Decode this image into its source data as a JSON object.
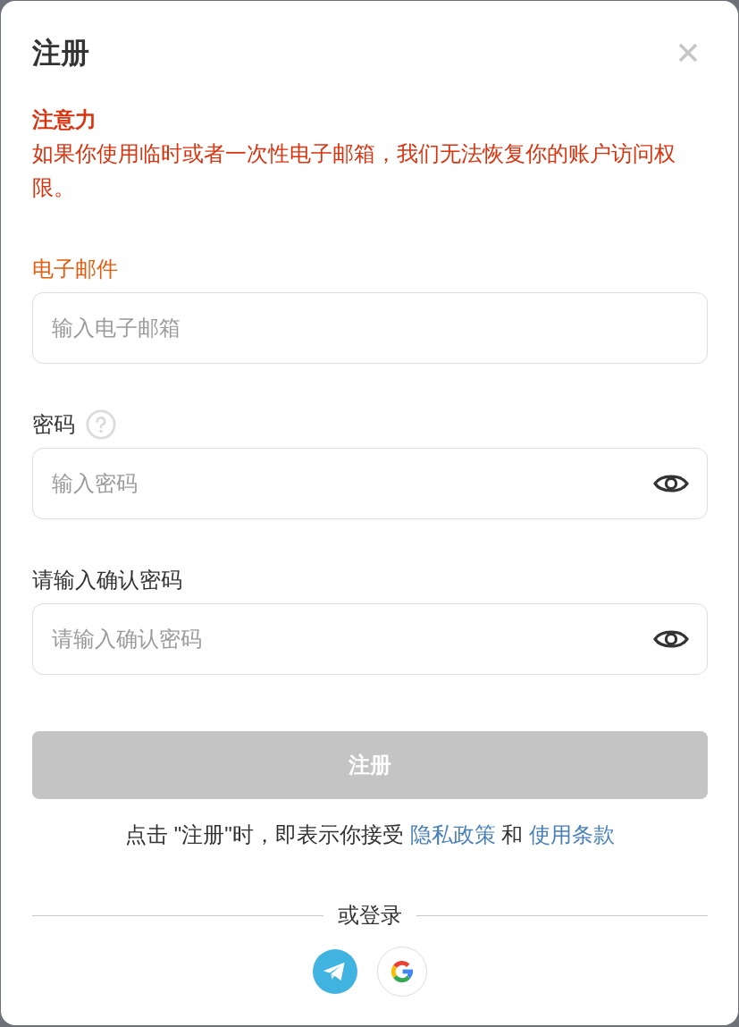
{
  "dialog": {
    "title": "注册"
  },
  "notice": {
    "heading": "注意力",
    "text": "如果你使用临时或者一次性电子邮箱，我们无法恢复你的账户访问权限。"
  },
  "fields": [
    {
      "label": "电子邮件",
      "placeholder": "输入电子邮箱",
      "highlighted": true,
      "help": false,
      "reveal_toggle": false
    },
    {
      "label": "密码",
      "placeholder": "输入密码",
      "highlighted": false,
      "help": true,
      "reveal_toggle": true
    },
    {
      "label": "请输入确认密码",
      "placeholder": "请输入确认密码",
      "highlighted": false,
      "help": false,
      "reveal_toggle": true
    }
  ],
  "submit": {
    "label": "注册",
    "disabled": true
  },
  "terms": [
    {
      "kind": "text",
      "text": "点击 \"注册\"时，即表示你接受"
    },
    {
      "kind": "link",
      "text": "隐私政策"
    },
    {
      "kind": "text",
      "text": "和"
    },
    {
      "kind": "link",
      "text": "使用条款"
    }
  ],
  "alt_login": {
    "label": "或登录",
    "providers": [
      {
        "kind": "paper-plane"
      },
      {
        "kind": "g-logo"
      }
    ]
  }
}
